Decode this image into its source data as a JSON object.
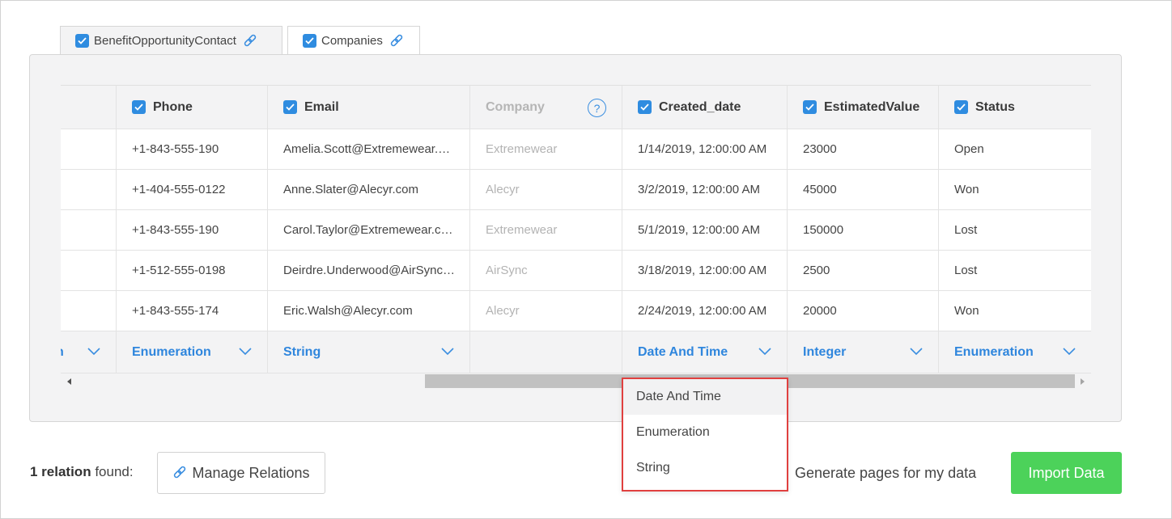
{
  "tabs": [
    {
      "label": "BenefitOpportunityContact",
      "checked": true,
      "active": true
    },
    {
      "label": "Companies",
      "checked": true,
      "active": false
    }
  ],
  "grid": {
    "columns": [
      {
        "label": "",
        "checked": false
      },
      {
        "label": "Phone",
        "checked": true
      },
      {
        "label": "Email",
        "checked": true
      },
      {
        "label": "Company",
        "checked": false,
        "disabled": true,
        "help": "?"
      },
      {
        "label": "Created_date",
        "checked": true
      },
      {
        "label": "EstimatedValue",
        "checked": true
      },
      {
        "label": "Status",
        "checked": true
      }
    ],
    "rows": [
      [
        "",
        "+1-843-555-190",
        "Amelia.Scott@Extremewear.com",
        "Extremewear",
        "1/14/2019, 12:00:00 AM",
        "23000",
        "Open"
      ],
      [
        "",
        "+1-404-555-0122",
        "Anne.Slater@Alecyr.com",
        "Alecyr",
        "3/2/2019, 12:00:00 AM",
        "45000",
        "Won"
      ],
      [
        "",
        "+1-843-555-190",
        "Carol.Taylor@Extremewear.com",
        "Extremewear",
        "5/1/2019, 12:00:00 AM",
        "150000",
        "Lost"
      ],
      [
        "",
        "+1-512-555-0198",
        "Deirdre.Underwood@AirSync.com",
        "AirSync",
        "3/18/2019, 12:00:00 AM",
        "2500",
        "Lost"
      ],
      [
        "",
        "+1-843-555-174",
        "Eric.Walsh@Alecyr.com",
        "Alecyr",
        "2/24/2019, 12:00:00 AM",
        "20000",
        "Won"
      ]
    ],
    "types": [
      "n",
      "Enumeration",
      "String",
      "",
      "Date And Time",
      "Integer",
      "Enumeration"
    ]
  },
  "dropdown": {
    "options": [
      "Date And Time",
      "Enumeration",
      "String"
    ],
    "selected": "Date And Time"
  },
  "footer": {
    "relation_count_bold": "1 relation",
    "relation_suffix": " found:",
    "manage_relations_label": "Manage Relations",
    "generate_pages_label": "Generate pages for my data",
    "import_label": "Import Data"
  },
  "colors": {
    "accent": "#2f8ce0",
    "import_button": "#4cd25a",
    "dropdown_border": "#e0403f"
  },
  "icons": {
    "checkbox": "checkbox-checked-icon",
    "link": "link-icon",
    "help": "help-circle-icon",
    "chevron": "chevron-down-icon"
  }
}
